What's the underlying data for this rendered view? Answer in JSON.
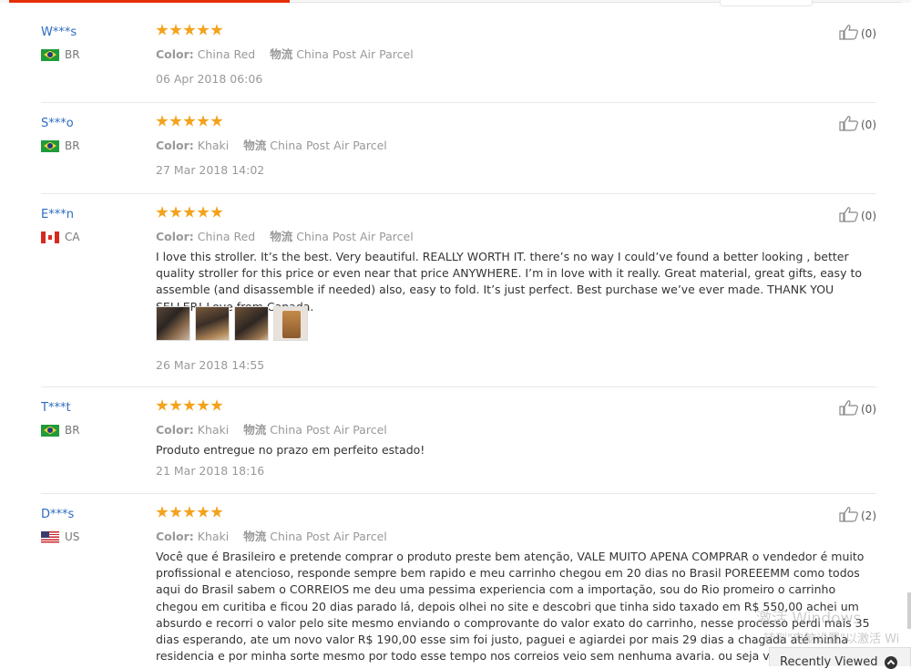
{
  "labels": {
    "color_key": "Color:",
    "shipping_key": "物流"
  },
  "reviews": [
    {
      "user": "W***s",
      "country": "BR",
      "color": "China Red",
      "shipping": "China Post Air Parcel",
      "date": "06 Apr 2018 06:06",
      "likes": "(0)",
      "text": ""
    },
    {
      "user": "S***o",
      "country": "BR",
      "color": "Khaki",
      "shipping": "China Post Air Parcel",
      "date": "27 Mar 2018 14:02",
      "likes": "(0)",
      "text": ""
    },
    {
      "user": "E***n",
      "country": "CA",
      "color": "China Red",
      "shipping": "China Post Air Parcel",
      "date": "26 Mar 2018 14:55",
      "likes": "(0)",
      "text": "I love this stroller. It’s the best. Very beautiful. REALLY WORTH IT. there’s no way I could’ve found a better looking , better quality stroller for this price or even near that price ANYWHERE. I’m in love with it really. Great material, great gifts, easy to assemble (and disassemble if needed) also, easy to fold. It’s just perfect. Best purchase we’ve ever made. THANK YOU SELLER! Love from Canada."
    },
    {
      "user": "T***t",
      "country": "BR",
      "color": "Khaki",
      "shipping": "China Post Air Parcel",
      "date": "21 Mar 2018 18:16",
      "likes": "(0)",
      "text": "Produto entregue no prazo em perfeito estado!"
    },
    {
      "user": "D***s",
      "country": "US",
      "color": "Khaki",
      "shipping": "China Post Air Parcel",
      "date": "",
      "likes": "(2)",
      "text": "Você que é Brasileiro e pretende comprar o produto preste bem atenção, VALE MUITO APENA COMPRAR o vendedor é muito profissional e atencioso, responde sempre bem rapido e meu carrinho chegou em 20 dias no Brasil POREEEMM como todos aqui do Brasil sabem o CORREIOS me deu uma pessima experiencia com a importação, sou do Rio promeiro o carrinho chegou em curitiba e ficou 20 dias parado lá, depois olhei no site e descobri que tinha sido taxado em R$ 550,00 achei um absurdo e recorri o valor pelo site mesmo enviando o comprovante do valor exato do carrinho, nesse processo perdi mais 35 dias esperando, ate um novo valor R$ 190,00 esse sim foi justo, paguei e agiardei por mais 29 dias a chagada até minha residencia e por minha sorte mesmo por todo esse tempo nos correios veio sem nenhuma avaria. ou seja vale comprar, mas tenha MUITA PA"
    }
  ],
  "watermark": {
    "line1": "激活 Windows",
    "line2": "转到\"电脑设置\"以激活 Wi"
  },
  "recently_viewed": {
    "label": "Recently Viewed"
  }
}
